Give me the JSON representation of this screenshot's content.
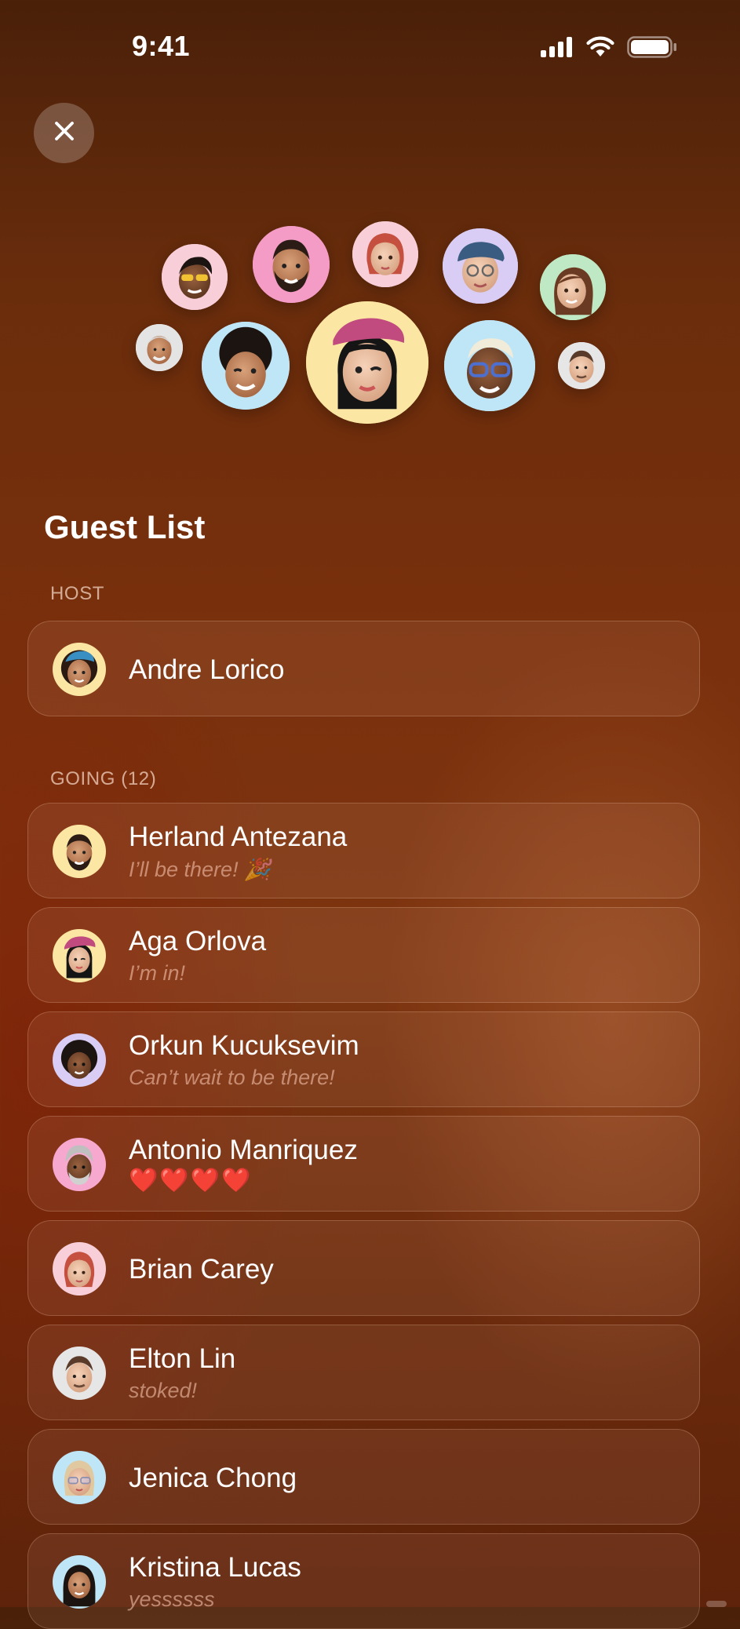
{
  "status_bar": {
    "time": "9:41"
  },
  "icons": {
    "close": "close-icon",
    "signal": "cellular-signal-icon",
    "wifi": "wifi-icon",
    "battery": "battery-icon"
  },
  "page": {
    "title": "Guest List"
  },
  "sections": {
    "host_label": "HOST",
    "going_label": "GOING (12)"
  },
  "host": {
    "name": "Andre Lorico"
  },
  "going": [
    {
      "name": "Herland Antezana",
      "note": "I’ll be there! 🎉"
    },
    {
      "name": "Aga Orlova",
      "note": "I’m in!"
    },
    {
      "name": "Orkun Kucuksevim",
      "note": "Can’t wait to be there!"
    },
    {
      "name": "Antonio Manriquez",
      "note": "❤️❤️❤️❤️"
    },
    {
      "name": "Brian Carey",
      "note": ""
    },
    {
      "name": "Elton Lin",
      "note": "stoked!"
    },
    {
      "name": "Jenica Chong",
      "note": ""
    },
    {
      "name": "Kristina Lucas",
      "note": "yessssss"
    }
  ],
  "colors": {
    "bubble_yellow": "#fbe7a3",
    "bubble_blue": "#bfe6f7",
    "bubble_pink": "#f7a8cf",
    "bubble_purple": "#d9cdf5",
    "bubble_green": "#bfe9c4",
    "bubble_rose": "#f8cfd8",
    "bubble_grey": "#e6e6e6"
  }
}
